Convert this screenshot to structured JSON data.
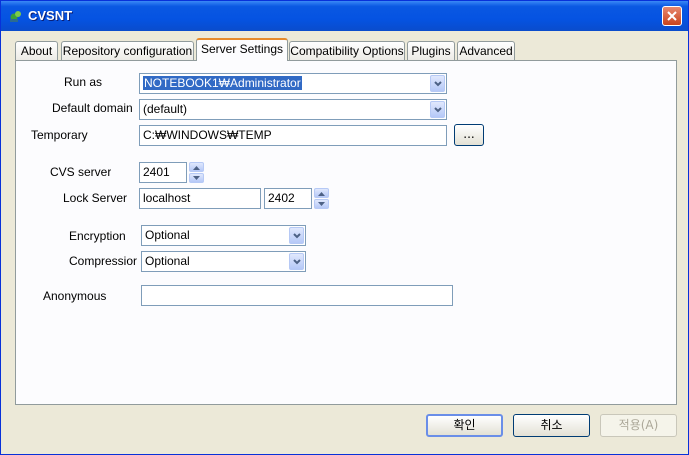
{
  "window": {
    "title": "CVSNT"
  },
  "tabs": [
    "About",
    "Repository configuration",
    "Server Settings",
    "Compatibility Options",
    "Plugins",
    "Advanced"
  ],
  "active_tab": "Server Settings",
  "form": {
    "run_as": {
      "label": "Run as",
      "value": "NOTEBOOK1₩Administrator"
    },
    "default_domain": {
      "label": "Default domain",
      "value": "(default)"
    },
    "temporary": {
      "label": "Temporary",
      "value": "C:₩WINDOWS₩TEMP",
      "browse_label": "..."
    },
    "cvs_server": {
      "label": "CVS server",
      "port": "2401"
    },
    "lock_server": {
      "label": "Lock Server",
      "host": "localhost",
      "port": "2402"
    },
    "encryption": {
      "label": "Encryption",
      "value": "Optional"
    },
    "compression": {
      "label": "Compressior",
      "value": "Optional"
    },
    "anonymous": {
      "label": "Anonymous",
      "value": ""
    }
  },
  "buttons": {
    "ok": "확인",
    "cancel": "취소",
    "apply": "적용(A)"
  },
  "colors": {
    "titlebar": "#0553e2",
    "selection": "#316ac5",
    "active_tab_accent": "#e68b2c",
    "dialog_bg": "#ece9d8"
  },
  "icons": {
    "app": "cvsnt-app-icon",
    "close": "close-icon",
    "dropdown": "chevron-down-icon",
    "spinner": "spinner-arrows-icon"
  }
}
